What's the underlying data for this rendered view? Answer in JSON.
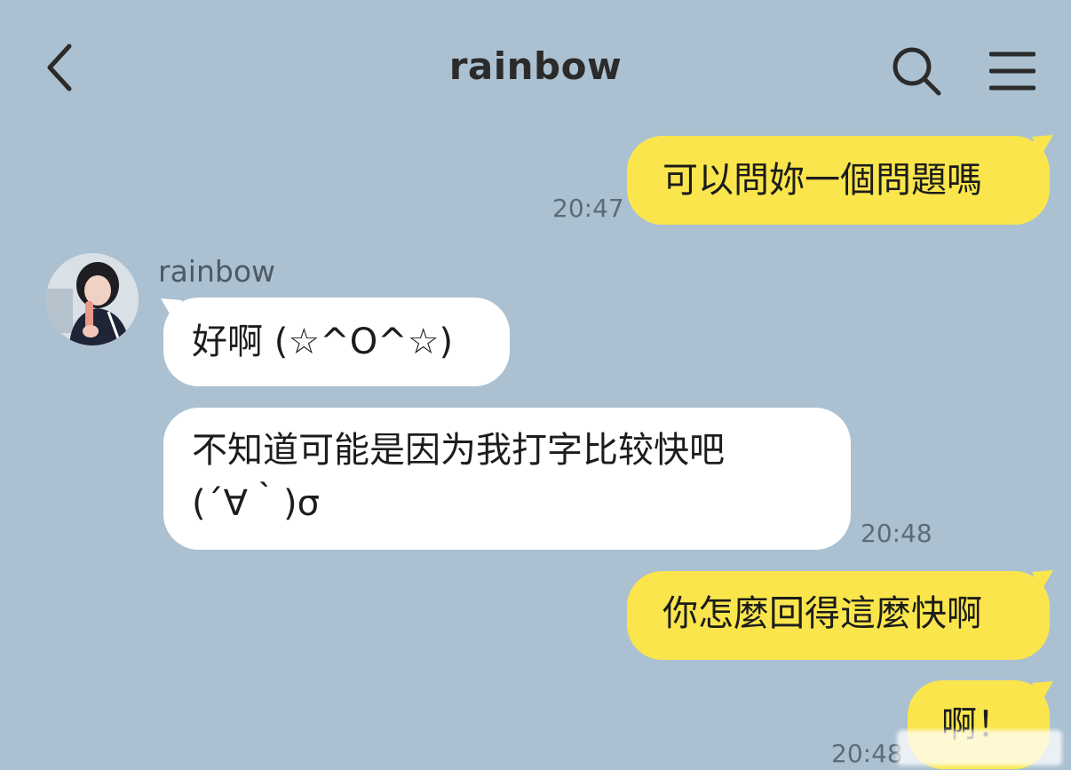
{
  "header": {
    "title": "rainbow",
    "back_icon": "chevron-left-icon",
    "search_icon": "search-icon",
    "menu_icon": "hamburger-menu-icon"
  },
  "colors": {
    "background": "#abc1d1",
    "sent_bubble": "#fae64c",
    "received_bubble": "#ffffff"
  },
  "contact": {
    "name": "rainbow"
  },
  "messages": [
    {
      "direction": "sent",
      "text": "可以問妳一個問題嗎",
      "time": "20:47"
    },
    {
      "direction": "received",
      "text": "好啊 (☆^O^☆)",
      "time": ""
    },
    {
      "direction": "received",
      "lines": [
        "不知道可能是因为我打字比较快吧",
        "(´∀｀)σ"
      ],
      "time": "20:48"
    },
    {
      "direction": "sent",
      "text": "你怎麼回得這麼快啊",
      "time": ""
    },
    {
      "direction": "sent",
      "text": "啊！",
      "time": "20:48"
    }
  ]
}
